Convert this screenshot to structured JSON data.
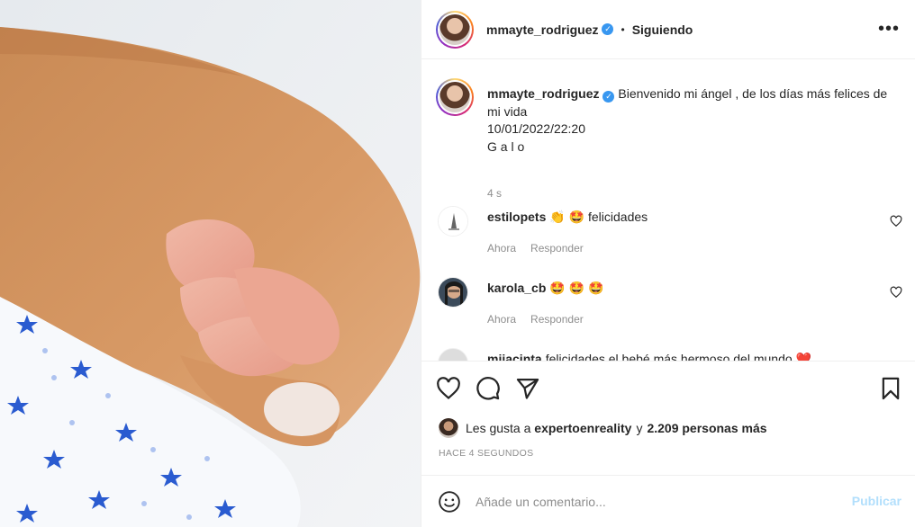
{
  "header": {
    "username": "mmayte_rodriguez",
    "verified_icon": "verified-badge-icon",
    "separator": "•",
    "follow_status": "Siguiendo",
    "more_icon": "more-options-icon",
    "more_label": "•••"
  },
  "caption": {
    "username": "mmayte_rodriguez",
    "line1": "Bienvenido mi ángel , de los días más felices de mi vida",
    "line2": "10/01/2022/22:20",
    "line3": "G a l o",
    "time": "4 s"
  },
  "comments": [
    {
      "username": "estilopets",
      "text": "👏 🤩  felicidades",
      "time": "Ahora",
      "reply": "Responder"
    },
    {
      "username": "karola_cb",
      "text": "🤩 🤩 🤩",
      "time": "Ahora",
      "reply": "Responder"
    },
    {
      "username": "miiacinta",
      "text": "felicidades el bebé más hermoso del mundo ❤️",
      "time": "",
      "reply": ""
    }
  ],
  "actions": {
    "like_icon": "heart-icon",
    "comment_icon": "comment-bubble-icon",
    "share_icon": "paper-plane-icon",
    "save_icon": "bookmark-icon"
  },
  "likes": {
    "prefix": "Les gusta a",
    "user": "expertoenreality",
    "connector": "y",
    "others": "2.209 personas más"
  },
  "timestamp": "HACE 4 SEGUNDOS",
  "add_comment": {
    "emoji_icon": "emoji-smiley-icon",
    "placeholder": "Añade un comentario...",
    "publish_label": "Publicar"
  },
  "colors": {
    "text": "#262626",
    "muted": "#8e8e8e",
    "verified": "#3897f0",
    "publish_disabled": "#b2dffc",
    "border": "#efefef"
  }
}
